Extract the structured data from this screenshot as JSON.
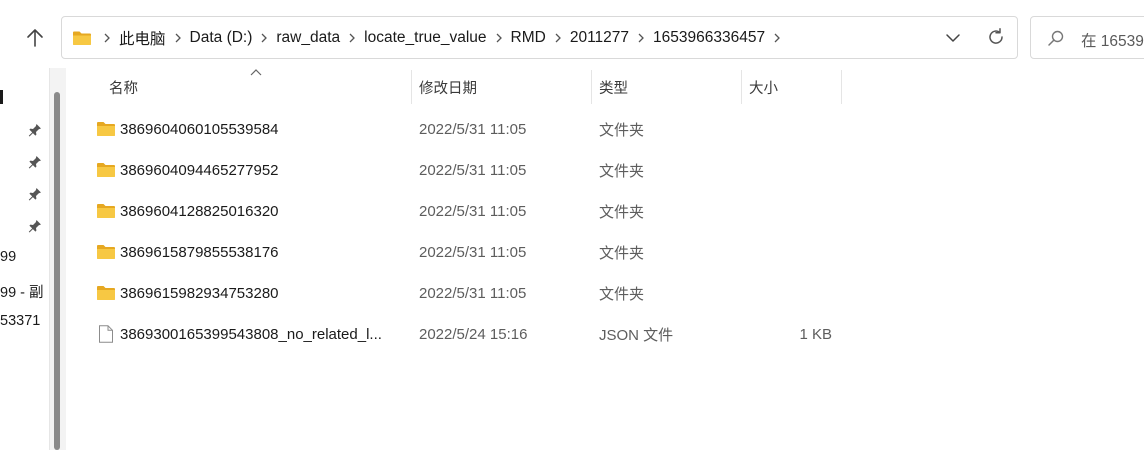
{
  "nav": {
    "up_label": "Up"
  },
  "address": {
    "crumbs": [
      "此电脑",
      "Data (D:)",
      "raw_data",
      "locate_true_value",
      "RMD",
      "2011277",
      "1653966336457"
    ]
  },
  "search": {
    "placeholder": "在 16539"
  },
  "sidebar": {
    "fragments": [
      "99",
      "99 - 副",
      "53371"
    ]
  },
  "columns": {
    "name": "名称",
    "date": "修改日期",
    "type": "类型",
    "size": "大小"
  },
  "files": [
    {
      "name": "3869604060105539584",
      "date": "2022/5/31 11:05",
      "type": "文件夹",
      "size": "",
      "icon": "folder-icon"
    },
    {
      "name": "3869604094465277952",
      "date": "2022/5/31 11:05",
      "type": "文件夹",
      "size": "",
      "icon": "folder-icon"
    },
    {
      "name": "3869604128825016320",
      "date": "2022/5/31 11:05",
      "type": "文件夹",
      "size": "",
      "icon": "folder-icon"
    },
    {
      "name": "3869615879855538176",
      "date": "2022/5/31 11:05",
      "type": "文件夹",
      "size": "",
      "icon": "folder-icon"
    },
    {
      "name": "3869615982934753280",
      "date": "2022/5/31 11:05",
      "type": "文件夹",
      "size": "",
      "icon": "folder-icon"
    },
    {
      "name": "3869300165399543808_no_related_l...",
      "date": "2022/5/24 15:16",
      "type": "JSON 文件",
      "size": "1 KB",
      "icon": "file-icon"
    }
  ],
  "colors": {
    "folder": "#f7c843",
    "folder_dark": "#e6a821",
    "text_secondary": "#5d5d5d"
  }
}
